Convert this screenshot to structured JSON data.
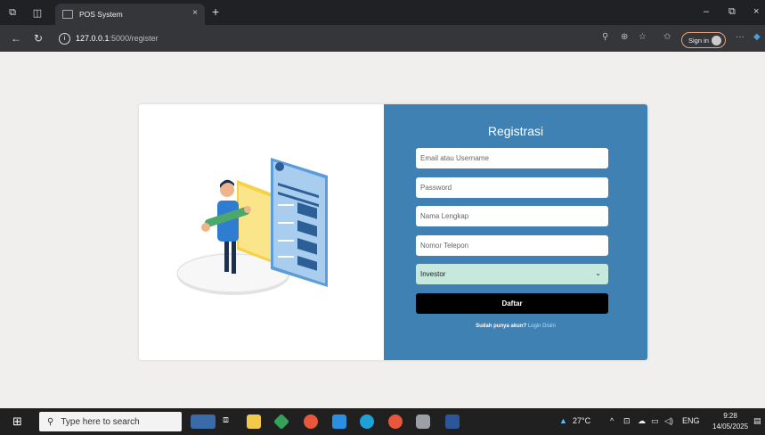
{
  "browser": {
    "tab_title": "POS System",
    "tab_close": "×",
    "new_tab": "+",
    "url_host": "127.0.0.1",
    "url_path": ":5000/register",
    "sign_in": "Sign in",
    "more": "···",
    "minimize": "–",
    "restore": "⧉",
    "close": "×"
  },
  "form": {
    "title": "Registrasi",
    "email_placeholder": "Email atau Username",
    "password_placeholder": "Password",
    "name_placeholder": "Nama Lengkap",
    "phone_placeholder": "Nomor Telepon",
    "role_selected": "Investor",
    "submit_label": "Daftar",
    "login_prompt": "Sudah punya akun?",
    "login_link": "Login Disini"
  },
  "taskbar": {
    "search_placeholder": "Type here to search",
    "weather": "27°C",
    "language": "ENG",
    "time": "9:28",
    "date": "14/05/2025"
  },
  "colors": {
    "panel": "#3f81b3",
    "button": "#000000",
    "select": "#c6e8dd"
  }
}
